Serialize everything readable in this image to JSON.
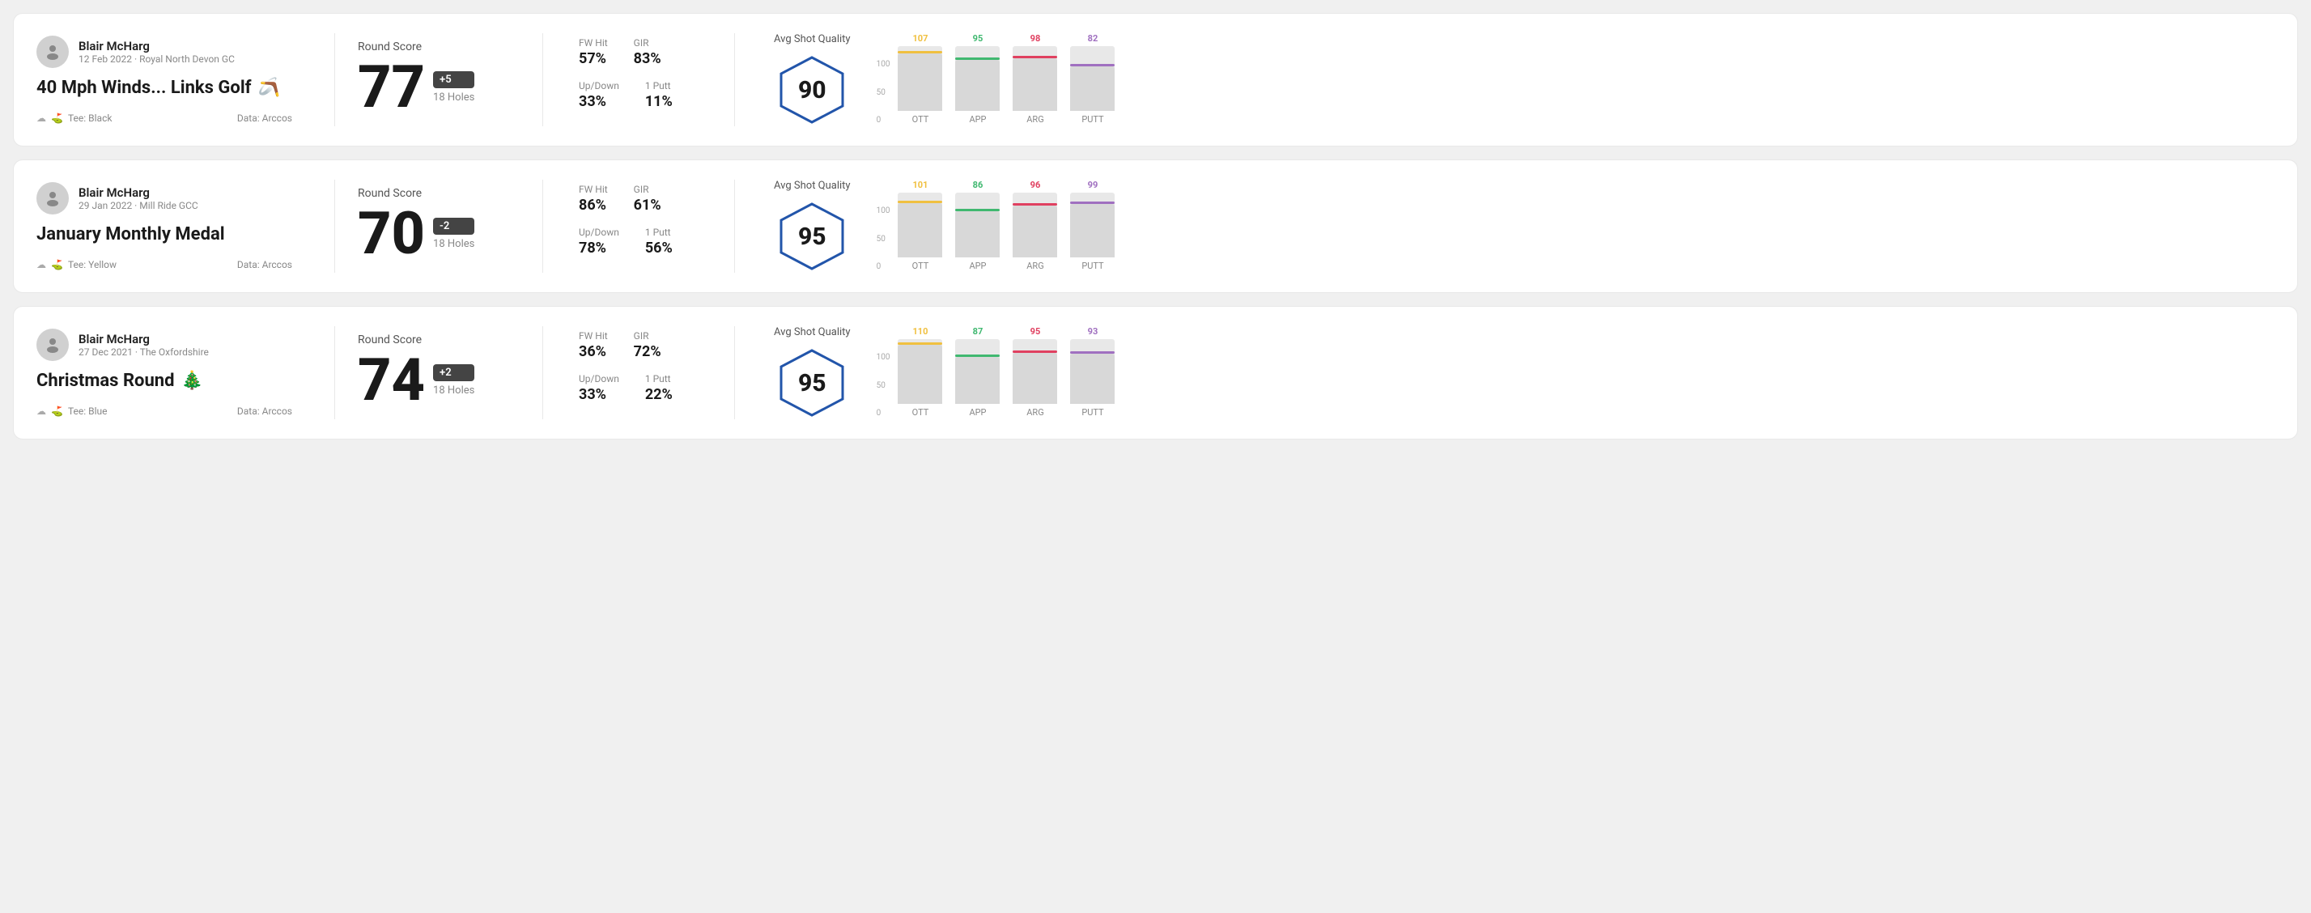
{
  "cards": [
    {
      "id": "card1",
      "user_name": "Blair McHarg",
      "user_meta": "12 Feb 2022 · Royal North Devon GC",
      "round_title": "40 Mph Winds... Links Golf",
      "round_emoji": "🪃",
      "tee": "Tee: Black",
      "data_source": "Data: Arccos",
      "round_score_label": "Round Score",
      "score": "77",
      "score_diff": "+5",
      "holes": "18 Holes",
      "fw_hit_label": "FW Hit",
      "fw_hit": "57%",
      "gir_label": "GIR",
      "gir": "83%",
      "updown_label": "Up/Down",
      "updown": "33%",
      "oneputt_label": "1 Putt",
      "oneputt": "11%",
      "avg_shot_quality_label": "Avg Shot Quality",
      "avg_shot_quality": "90",
      "bars": [
        {
          "label": "OTT",
          "value": 107,
          "color": "#f0c040",
          "pct": 107
        },
        {
          "label": "APP",
          "value": 95,
          "color": "#40b870",
          "pct": 95
        },
        {
          "label": "ARG",
          "value": 98,
          "color": "#e04060",
          "pct": 98
        },
        {
          "label": "PUTT",
          "value": 82,
          "color": "#a070c0",
          "pct": 82
        }
      ]
    },
    {
      "id": "card2",
      "user_name": "Blair McHarg",
      "user_meta": "29 Jan 2022 · Mill Ride GCC",
      "round_title": "January Monthly Medal",
      "round_emoji": "",
      "tee": "Tee: Yellow",
      "data_source": "Data: Arccos",
      "round_score_label": "Round Score",
      "score": "70",
      "score_diff": "-2",
      "holes": "18 Holes",
      "fw_hit_label": "FW Hit",
      "fw_hit": "86%",
      "gir_label": "GIR",
      "gir": "61%",
      "updown_label": "Up/Down",
      "updown": "78%",
      "oneputt_label": "1 Putt",
      "oneputt": "56%",
      "avg_shot_quality_label": "Avg Shot Quality",
      "avg_shot_quality": "95",
      "bars": [
        {
          "label": "OTT",
          "value": 101,
          "color": "#f0c040",
          "pct": 101
        },
        {
          "label": "APP",
          "value": 86,
          "color": "#40b870",
          "pct": 86
        },
        {
          "label": "ARG",
          "value": 96,
          "color": "#e04060",
          "pct": 96
        },
        {
          "label": "PUTT",
          "value": 99,
          "color": "#a070c0",
          "pct": 99
        }
      ]
    },
    {
      "id": "card3",
      "user_name": "Blair McHarg",
      "user_meta": "27 Dec 2021 · The Oxfordshire",
      "round_title": "Christmas Round",
      "round_emoji": "🎄",
      "tee": "Tee: Blue",
      "data_source": "Data: Arccos",
      "round_score_label": "Round Score",
      "score": "74",
      "score_diff": "+2",
      "holes": "18 Holes",
      "fw_hit_label": "FW Hit",
      "fw_hit": "36%",
      "gir_label": "GIR",
      "gir": "72%",
      "updown_label": "Up/Down",
      "updown": "33%",
      "oneputt_label": "1 Putt",
      "oneputt": "22%",
      "avg_shot_quality_label": "Avg Shot Quality",
      "avg_shot_quality": "95",
      "bars": [
        {
          "label": "OTT",
          "value": 110,
          "color": "#f0c040",
          "pct": 110
        },
        {
          "label": "APP",
          "value": 87,
          "color": "#40b870",
          "pct": 87
        },
        {
          "label": "ARG",
          "value": 95,
          "color": "#e04060",
          "pct": 95
        },
        {
          "label": "PUTT",
          "value": 93,
          "color": "#a070c0",
          "pct": 93
        }
      ]
    }
  ]
}
